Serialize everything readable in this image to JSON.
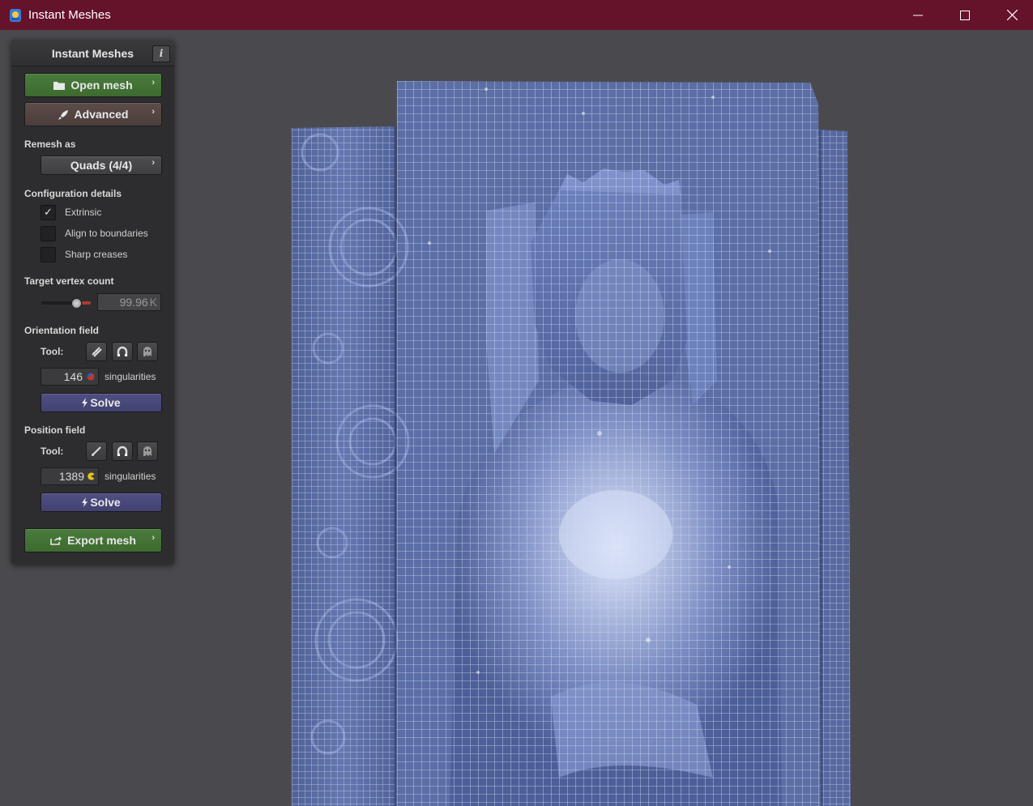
{
  "window": {
    "title": "Instant Meshes",
    "controls": [
      "minimize",
      "maximize",
      "close"
    ]
  },
  "panel": {
    "title": "Instant Meshes",
    "info_label": "i",
    "open_mesh_label": "Open mesh",
    "advanced_label": "Advanced",
    "remesh_as_label": "Remesh as",
    "remesh_mode": "Quads (4/4)",
    "config_label": "Configuration details",
    "options": [
      {
        "label": "Extrinsic",
        "checked": true
      },
      {
        "label": "Align to boundaries",
        "checked": false
      },
      {
        "label": "Sharp creases",
        "checked": false
      }
    ],
    "target_vertex_label": "Target vertex count",
    "target_vertex_value": "99.96",
    "target_vertex_unit": "K",
    "orientation": {
      "label": "Orientation field",
      "tool_label": "Tool:",
      "tools": [
        "comb-icon",
        "attractor-icon",
        "ghost-icon"
      ],
      "singularities": "146",
      "singularities_label": "singularities",
      "solve_label": "Solve"
    },
    "position": {
      "label": "Position field",
      "tool_label": "Tool:",
      "tools": [
        "brush-icon",
        "attractor-icon",
        "ghost-icon"
      ],
      "singularities": "1389",
      "singularities_label": "singularities",
      "solve_label": "Solve"
    },
    "export_label": "Export mesh"
  },
  "colors": {
    "titlebar": "#65122b",
    "viewport": "#4a4a4e",
    "panel": "#2d2d2f",
    "mesh": "#5a6fa8",
    "wire": "#c8d2ee",
    "green_button": "#4a7c3b",
    "solve_button": "#4f4f83"
  }
}
